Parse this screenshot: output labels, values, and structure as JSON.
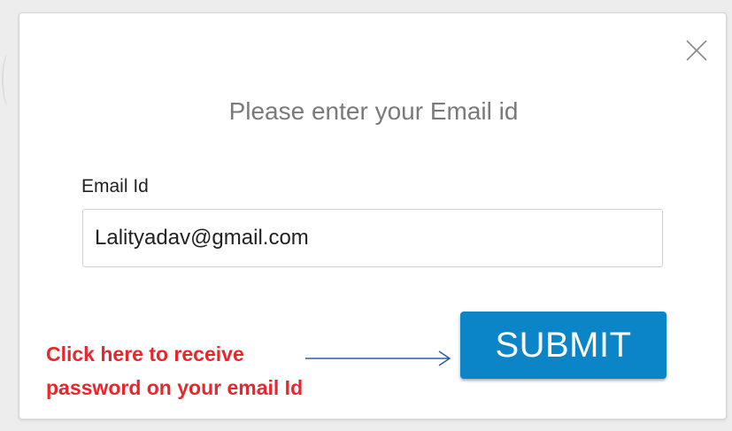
{
  "dialog": {
    "title": "Please enter your Email id",
    "close_icon": "close-x-icon",
    "email_label": "Email Id",
    "email_value": "Lalityadav@gmail.com",
    "submit_label": "SUBMIT"
  },
  "annotation": {
    "line1": "Click here to receive",
    "line2": "password on your email Id",
    "arrow_icon": "right-arrow-icon",
    "color": "#e8262d",
    "arrow_color": "#2f5f9e"
  },
  "colors": {
    "submit_bg": "#0b84c8",
    "title_text": "#7a7a7a"
  }
}
